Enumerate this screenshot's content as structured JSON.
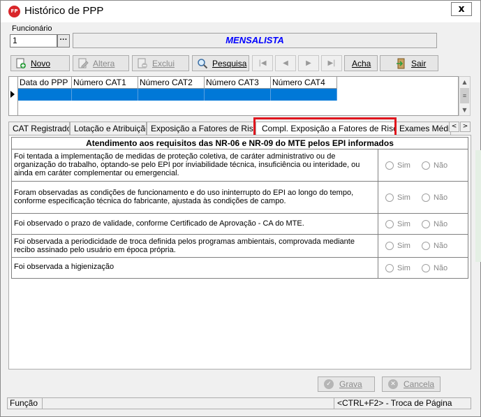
{
  "window": {
    "title": "Histórico de PPP",
    "logo_text": "FP",
    "close_glyph": "x"
  },
  "funcionario": {
    "label": "Funcionário",
    "value": "1",
    "lookup_glyph": "···",
    "name": "MENSALISTA"
  },
  "toolbar": {
    "novo": "Novo",
    "altera": "Altera",
    "exclui": "Exclui",
    "pesquisa": "Pesquisa",
    "acha": "Acha",
    "sair": "Sair",
    "nav": [
      "|◀",
      "◀",
      "▶",
      "▶|"
    ]
  },
  "grid": {
    "columns": [
      "Data do PPP",
      "Número CAT1",
      "Número CAT2",
      "Número CAT3",
      "Número CAT4"
    ]
  },
  "tabs": {
    "items": [
      "CAT Registrado",
      "Lotação e Atribuição",
      "Exposição a Fatores de Riscos",
      "Compl. Exposição a Fatores de Riscos",
      "Exames Médicos"
    ],
    "active_index": 3,
    "prev_glyph": "<",
    "next_glyph": ">"
  },
  "epi": {
    "title": "Atendimento aos requisitos das NR-06 e NR-09 do MTE pelos EPI informados",
    "option_yes": "Sim",
    "option_no": "Não",
    "questions": [
      "Foi tentada a implementação de medidas de proteção coletiva, de caráter administrativo ou de organização do trabalho, optando-se pelo EPI por inviabilidade técnica, insuficiência ou interidade, ou ainda em caráter complementar ou emergencial.",
      "Foram observadas as condições de funcionamento e do uso ininterrupto do EPI ao longo do tempo, conforme especificação técnica do fabricante, ajustada às condições de campo.",
      "Foi observado o prazo de validade, conforme Certificado de Aprovação - CA do MTE.",
      "Foi observada a periodicidade de troca definida pelos programas ambientais, comprovada mediante recibo assinado pelo usuário em época própria.",
      "Foi observada a higienização"
    ]
  },
  "footer": {
    "grava": "Grava",
    "cancela": "Cancela"
  },
  "statusbar": {
    "left": "Função",
    "right": "<CTRL+F2> - Troca de Página"
  },
  "colors": {
    "accent": "#0078d7",
    "highlight": "#e0161e",
    "name_text": "#0000ff"
  }
}
